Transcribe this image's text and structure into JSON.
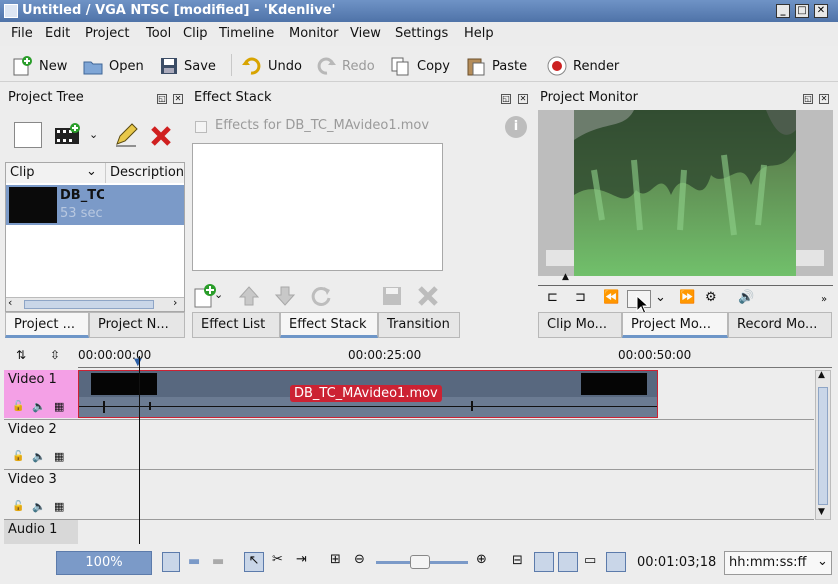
{
  "window": {
    "title": "Untitled / VGA NTSC [modified] - 'Kdenlive'"
  },
  "menu": [
    "File",
    "Edit",
    "Project",
    "Tool",
    "Clip",
    "Timeline",
    "Monitor",
    "View",
    "Settings",
    "Help"
  ],
  "toolbar": {
    "new": "New",
    "open": "Open",
    "save": "Save",
    "undo": "Undo",
    "redo": "Redo",
    "copy": "Copy",
    "paste": "Paste",
    "render": "Render"
  },
  "project_tree": {
    "title": "Project Tree",
    "col_clip": "Clip",
    "col_description": "Description",
    "clip_name": "DB_TC",
    "clip_duration": "53 sec",
    "tabs": [
      "Project ...",
      "Project N..."
    ]
  },
  "effect_stack": {
    "title": "Effect Stack",
    "checkbox_label": "Effects for DB_TC_MAvideo1.mov",
    "tabs": [
      "Effect List",
      "Effect Stack",
      "Transition"
    ]
  },
  "project_monitor": {
    "title": "Project Monitor",
    "tabs": [
      "Clip Mo...",
      "Project Mo...",
      "Record Mo..."
    ]
  },
  "timeline": {
    "ruler": [
      "00:00:00:00",
      "00:00:25:00",
      "00:00:50:00"
    ],
    "tracks": [
      "Video 1",
      "Video 2",
      "Video 3",
      "Audio 1"
    ],
    "clip_label": "DB_TC_MAvideo1.mov"
  },
  "status": {
    "zoom": "100%",
    "timecode": "00:01:03;18",
    "format": "hh:mm:ss:ff"
  },
  "colors": {
    "selection": "#7b9ac8",
    "clip_label_bg": "#cc2233",
    "track_selected": "#f4a0e6"
  }
}
